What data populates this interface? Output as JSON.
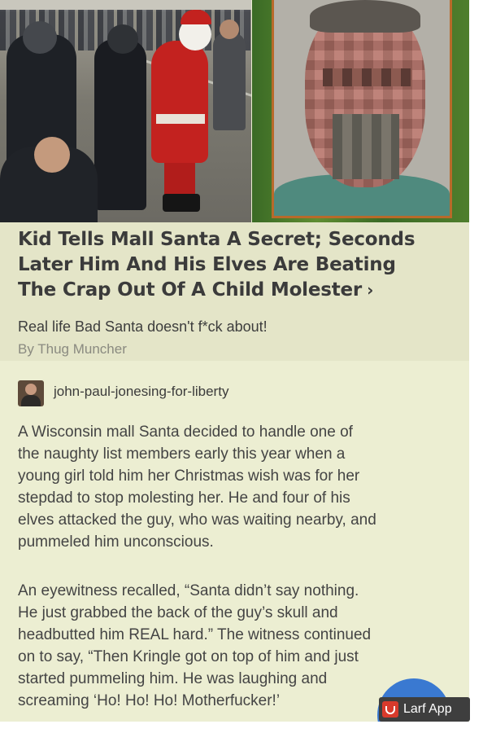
{
  "article": {
    "headline_lines": [
      "Kid Tells Mall Santa A Secret; Seconds",
      "Later Him And His Elves Are Beating",
      "The Crap Out Of A Child Molester"
    ],
    "chevron": "›",
    "subtitle": "Real life Bad Santa doesn't f*ck about!",
    "byline": "By Thug Muncher"
  },
  "post": {
    "username": "john-paul-jonesing-for-liberty",
    "paragraph1_lines": [
      "A Wisconsin mall Santa decided to handle one of",
      "the naughty list members early this year when a",
      "young girl told him her Christmas wish was for her",
      "stepdad to stop molesting her. He and four of his",
      "elves attacked the guy, who was waiting nearby, and",
      "pummeled him unconscious."
    ],
    "paragraph2_lines": [
      "An eyewitness recalled, “Santa didn’t say nothing.",
      "He just grabbed the back of the guy’s skull and",
      "headbutted him REAL hard.” The witness continued",
      "on to say, “Then Kringle got on top of him and just",
      "started pummeling him. He was laughing and",
      "screaming ‘Ho! Ho! Ho! Motherfucker!’"
    ]
  },
  "watermark": {
    "label": "Larf App",
    "icon": "larf-app-icon"
  },
  "images": {
    "left_photo": "santa-with-police-photo",
    "right_photo": "pixelated-mugshot-photo"
  },
  "colors": {
    "card_bg": "#eceed2",
    "headline_bg": "#e4e5c8",
    "headline_text": "#3b3b3b",
    "byline_text": "#8a8a80",
    "badge_bg": "#3e3e3e",
    "badge_icon": "#d83a2c",
    "circle": "#3a79d1"
  }
}
